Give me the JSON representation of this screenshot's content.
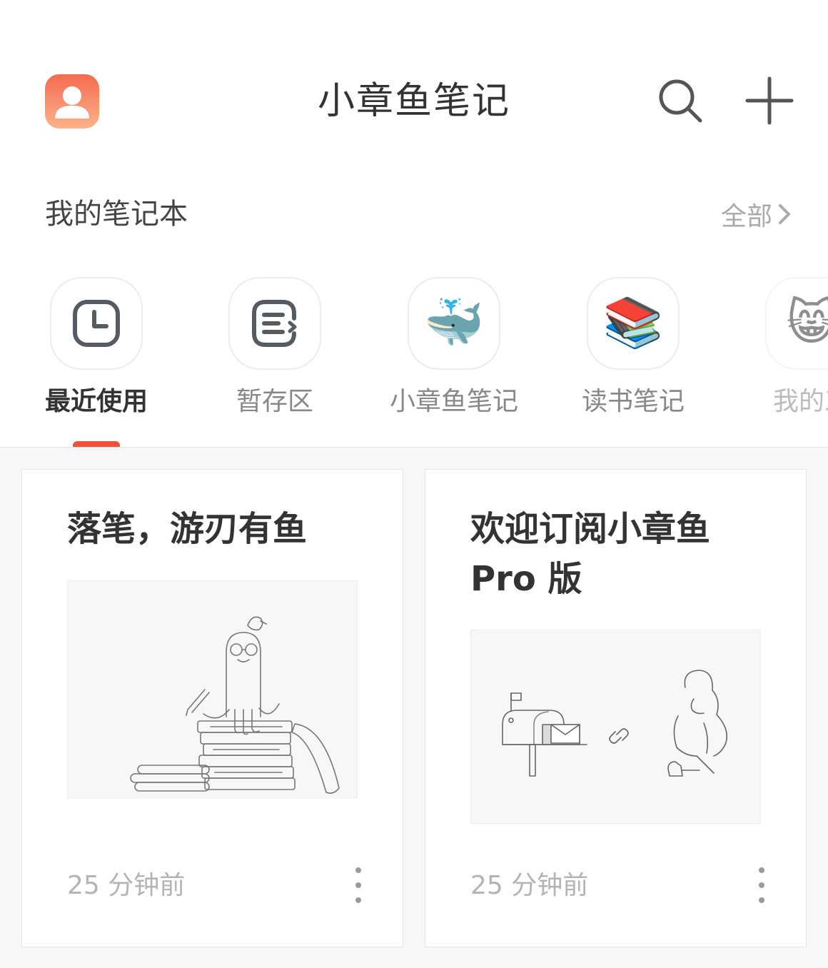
{
  "header": {
    "title": "小章鱼笔记",
    "avatar_icon": "user-avatar-icon",
    "search_icon": "search-icon",
    "add_icon": "plus-icon"
  },
  "notebooks": {
    "section_title": "我的笔记本",
    "see_all_label": "全部",
    "items": [
      {
        "label": "最近使用",
        "icon": "clock-icon",
        "active": true
      },
      {
        "label": "暂存区",
        "icon": "draft-icon",
        "active": false
      },
      {
        "label": "小章鱼笔记",
        "icon": "whale-emoji",
        "emoji": "🐳",
        "active": false
      },
      {
        "label": "读书笔记",
        "icon": "books-emoji",
        "emoji": "📚",
        "active": false
      },
      {
        "label": "我的工",
        "icon": "cat-emoji",
        "emoji": "😸",
        "active": false
      }
    ]
  },
  "notes": [
    {
      "title": "落笔，游刃有鱼",
      "time": "25 分钟前",
      "image": "octopus-books-illustration"
    },
    {
      "title": "欢迎订阅小章鱼 Pro 版",
      "time": "25 分钟前",
      "image": "mailbox-person-illustration"
    }
  ],
  "colors": {
    "accent": "#f2503a",
    "avatar_top": "#f46b4f",
    "avatar_bottom": "#fbb38a",
    "muted_text": "#b4b4b4"
  }
}
